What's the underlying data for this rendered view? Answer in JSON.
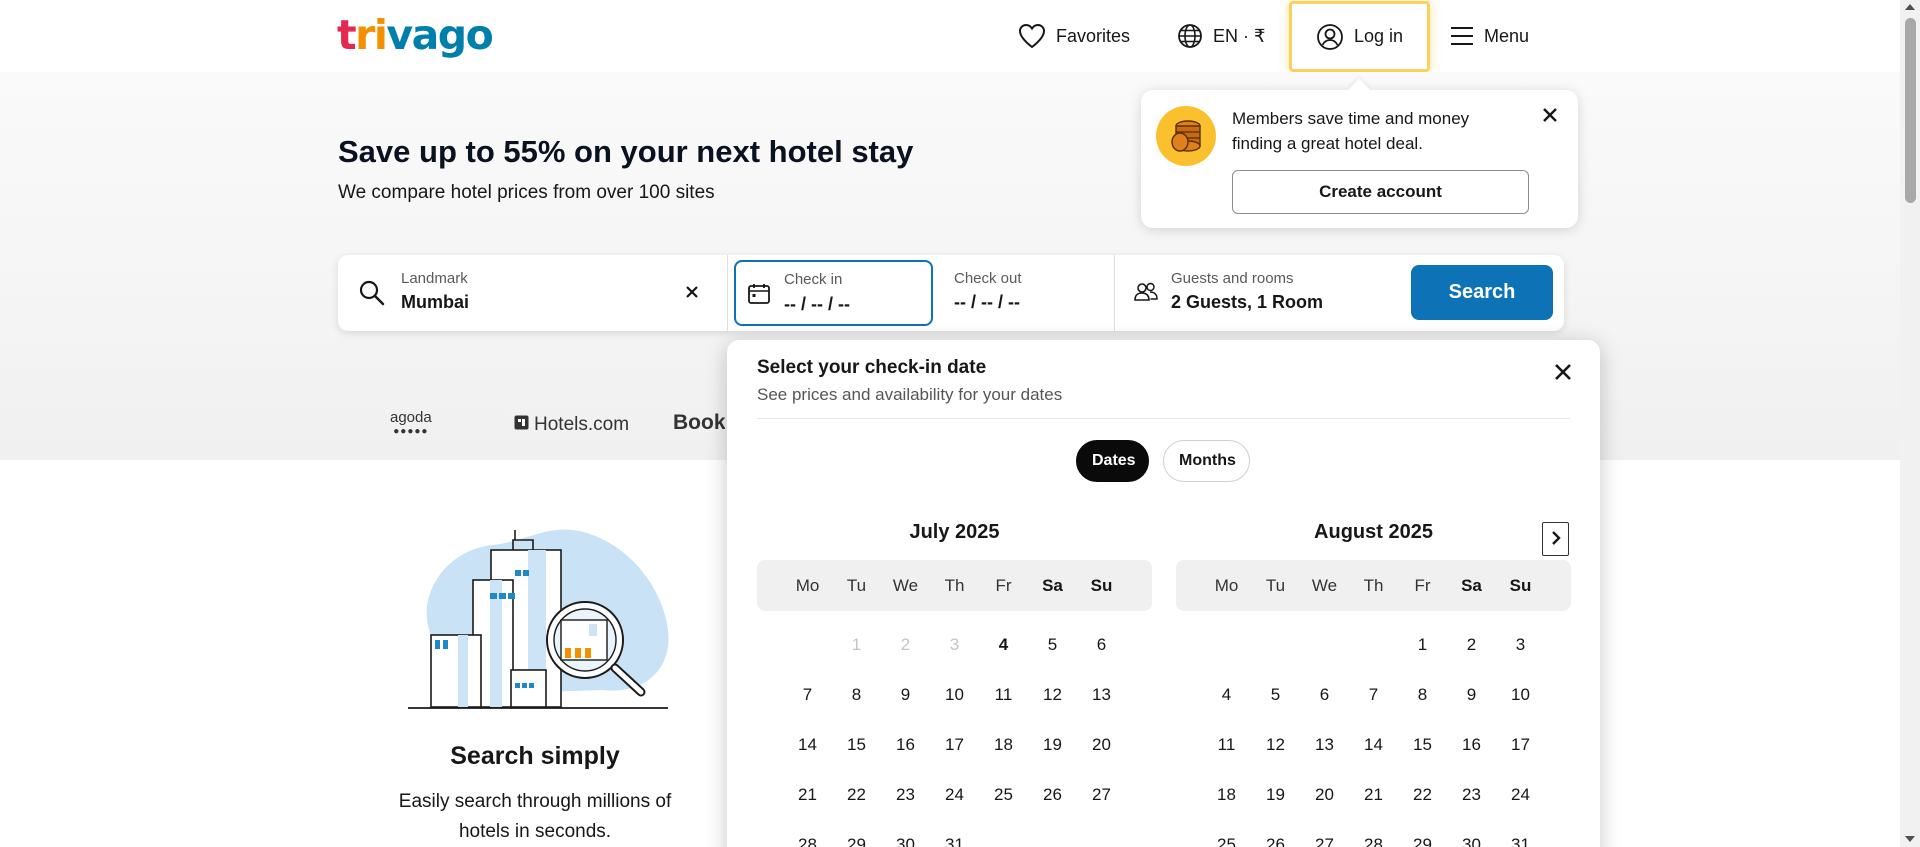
{
  "header": {
    "logo": {
      "part1": "t",
      "part2": "ri",
      "part3": "vago"
    },
    "favorites_label": "Favorites",
    "language_label": "EN · ₹",
    "login_label": "Log in",
    "menu_label": "Menu"
  },
  "hero": {
    "title": "Save up to 55% on your next hotel stay",
    "subtitle": "We compare hotel prices from over 100 sites"
  },
  "search": {
    "destination_label": "Landmark",
    "destination_value": "Mumbai",
    "checkin_label": "Check in",
    "checkin_value": "-- / -- / --",
    "checkout_label": "Check out",
    "checkout_value": "-- / -- / --",
    "guests_label": "Guests and rooms",
    "guests_value": "2 Guests, 1 Room",
    "search_button": "Search"
  },
  "partners": {
    "agoda": "agoda",
    "agoda_dots": "●●●●●",
    "hotels": "Hotels.com",
    "booking": "Booking.com"
  },
  "feature": {
    "title": "Search simply",
    "description": "Easily search through millions of hotels in seconds."
  },
  "login_tooltip": {
    "text": "Members save time and money finding a great hotel deal.",
    "button": "Create account"
  },
  "date_picker": {
    "title": "Select your check-in date",
    "subtitle": "See prices and availability for your dates",
    "toggle_dates": "Dates",
    "toggle_months": "Months",
    "weekdays": [
      "Mo",
      "Tu",
      "We",
      "Th",
      "Fr",
      "Sa",
      "Su"
    ],
    "months": [
      {
        "title": "July 2025",
        "offset": 1,
        "days": 31,
        "past_until": 3,
        "today": 4
      },
      {
        "title": "August 2025",
        "offset": 4,
        "days": 31,
        "past_until": 0,
        "today": 0
      }
    ]
  },
  "colors": {
    "brand_blue": "#0e72b7",
    "logo_red": "#e32851",
    "logo_orange": "#f48f00",
    "logo_blue": "#007fad",
    "highlight_yellow": "#fbd15e"
  }
}
